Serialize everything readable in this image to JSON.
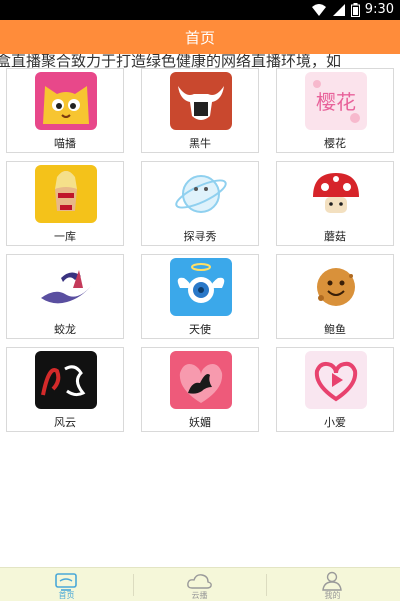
{
  "status": {
    "time": "9:30"
  },
  "header": {
    "title": "首页"
  },
  "marquee": {
    "text": "盒直播聚合致力于打造绿色健康的网络直播环境，如"
  },
  "apps": [
    {
      "label": "喵播",
      "icon": "cat-face-icon"
    },
    {
      "label": "黑牛",
      "icon": "bull-head-icon"
    },
    {
      "label": "樱花",
      "icon": "sakura-text-icon"
    },
    {
      "label": "一库",
      "icon": "bikini-girl-icon"
    },
    {
      "label": "探寻秀",
      "icon": "planet-icon"
    },
    {
      "label": "蘑菇",
      "icon": "mushroom-icon"
    },
    {
      "label": "蛟龙",
      "icon": "dragon-icon"
    },
    {
      "label": "天使",
      "icon": "angel-camera-icon"
    },
    {
      "label": "鲍鱼",
      "icon": "smiling-cookie-icon"
    },
    {
      "label": "风云",
      "icon": "calligraphy-icon"
    },
    {
      "label": "妖媚",
      "icon": "silhouette-woman-icon"
    },
    {
      "label": "小爱",
      "icon": "heart-play-icon"
    }
  ],
  "tabs": [
    {
      "label": "首页",
      "icon": "home-screen-icon",
      "active": true
    },
    {
      "label": "云播",
      "icon": "cloud-icon",
      "active": false
    },
    {
      "label": "我的",
      "icon": "person-icon",
      "active": false
    }
  ],
  "colors": {
    "header": "#ff8c3a",
    "tabbar": "#f5f7d9",
    "active_tab": "#4aa8d8"
  }
}
